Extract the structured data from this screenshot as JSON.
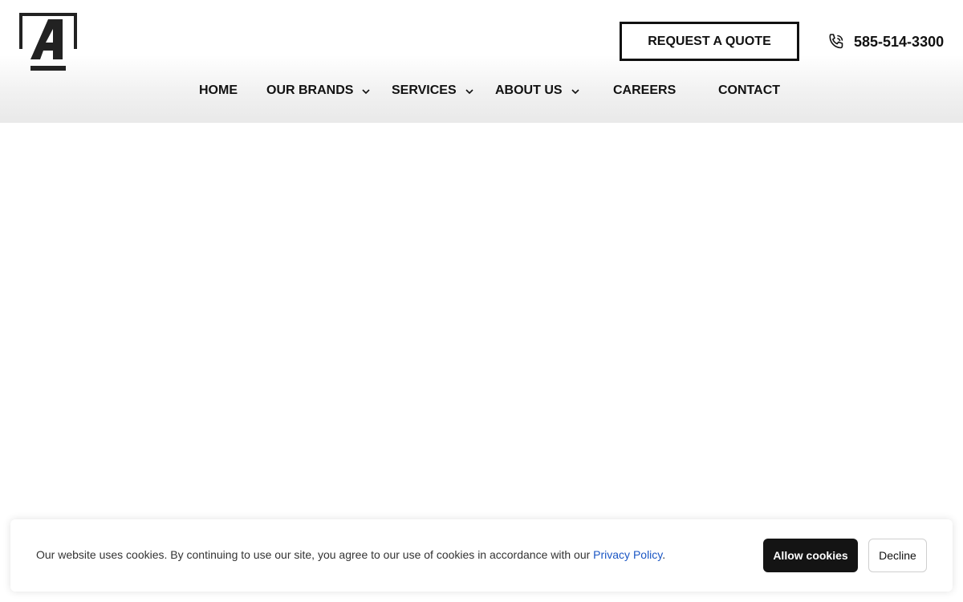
{
  "header": {
    "logo_icon": "letter-a-frame-logo",
    "quote_button": "REQUEST A QUOTE",
    "phone_icon": "phone-icon",
    "phone_number": "585-514-3300"
  },
  "nav": {
    "items": [
      {
        "label": "HOME",
        "has_dropdown": false
      },
      {
        "label": "OUR BRANDS",
        "has_dropdown": true
      },
      {
        "label": "SERVICES",
        "has_dropdown": true
      },
      {
        "label": "ABOUT US",
        "has_dropdown": true
      },
      {
        "label": "CAREERS",
        "has_dropdown": false
      },
      {
        "label": "CONTACT",
        "has_dropdown": false
      }
    ],
    "dropdown_icon": "chevron-down-icon"
  },
  "cookie_banner": {
    "message": "Our website uses cookies. By continuing to use our site, you agree to our use of cookies in accordance with our ",
    "link_text": "Privacy Policy",
    "trailing": ".",
    "allow_label": "Allow cookies",
    "decline_label": "Decline"
  },
  "colors": {
    "text": "#111111",
    "link": "#1a56c4",
    "allow_button_bg": "#141414",
    "page_bg": "#ffffff"
  }
}
